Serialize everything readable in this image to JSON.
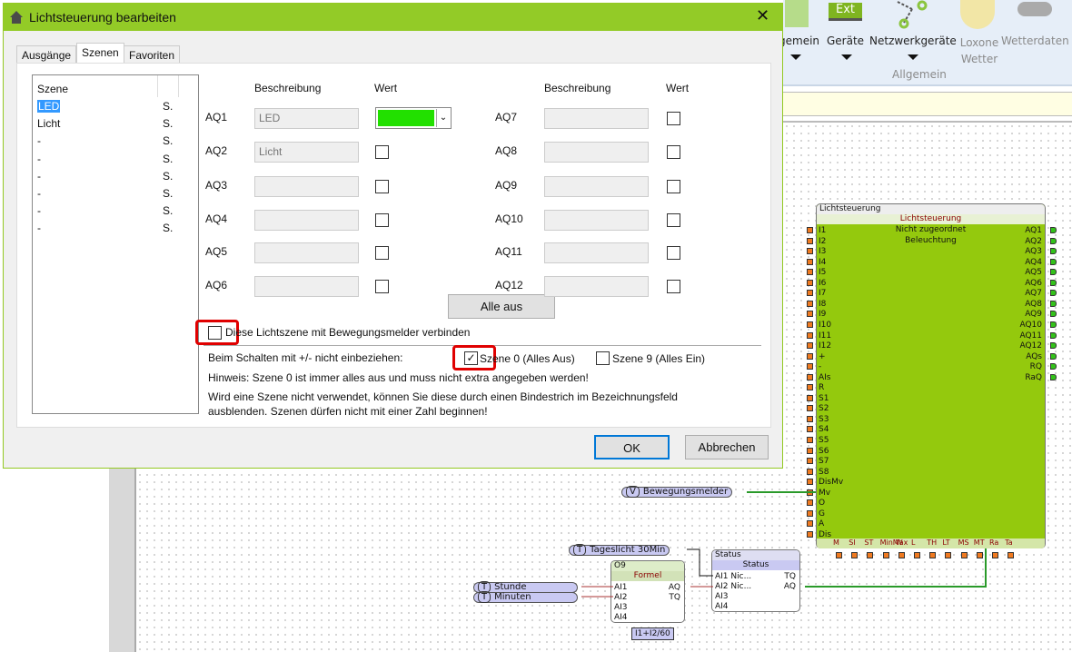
{
  "ribbon": {
    "items": [
      {
        "label": "gemein"
      },
      {
        "label": "Geräte"
      },
      {
        "label": "Netzwerkgeräte"
      },
      {
        "label": "Loxone Wetter"
      },
      {
        "label": "Wetterdaten"
      }
    ],
    "ext_label": "Ext",
    "group": "Allgemein"
  },
  "dialog": {
    "title": "Lichtsteuerung bearbeiten",
    "tabs": [
      "Ausgänge",
      "Szenen",
      "Favoriten"
    ],
    "active_tab": "Szenen",
    "scene_list": {
      "header": "Szene",
      "items": [
        {
          "name": "LED",
          "col": "S.",
          "selected": true
        },
        {
          "name": "Licht",
          "col": "S."
        },
        {
          "name": "-",
          "col": "S."
        },
        {
          "name": "-",
          "col": "S."
        },
        {
          "name": "-",
          "col": "S."
        },
        {
          "name": "-",
          "col": "S."
        },
        {
          "name": "-",
          "col": "S."
        },
        {
          "name": "-",
          "col": "S."
        }
      ]
    },
    "col_desc": "Beschreibung",
    "col_value": "Wert",
    "outputs_left": [
      {
        "label": "AQ1",
        "desc": "LED",
        "color": "#22e000"
      },
      {
        "label": "AQ2",
        "desc": "Licht"
      },
      {
        "label": "AQ3",
        "desc": ""
      },
      {
        "label": "AQ4",
        "desc": ""
      },
      {
        "label": "AQ5",
        "desc": ""
      },
      {
        "label": "AQ6",
        "desc": ""
      }
    ],
    "outputs_right": [
      {
        "label": "AQ7",
        "desc": ""
      },
      {
        "label": "AQ8",
        "desc": ""
      },
      {
        "label": "AQ9",
        "desc": ""
      },
      {
        "label": "AQ10",
        "desc": ""
      },
      {
        "label": "AQ11",
        "desc": ""
      },
      {
        "label": "AQ12",
        "desc": ""
      }
    ],
    "all_off": "Alle aus",
    "motion_checkbox": {
      "label": "Diese Lichtszene mit Bewegungsmelder verbinden",
      "checked": false
    },
    "exclude_label": "Beim Schalten mit +/- nicht einbeziehen:",
    "scene0": {
      "label": "Szene 0 (Alles Aus)",
      "checked": true
    },
    "scene9": {
      "label": "Szene 9 (Alles Ein)",
      "checked": false
    },
    "hint1": "Hinweis: Szene 0 ist immer alles aus und muss nicht extra angegeben werden!",
    "hint2": "Wird eine Szene nicht verwendet, können Sie diese durch einen Bindestrich im Bezeichnungsfeld",
    "hint3": "ausblenden. Szenen dürfen nicht mit einer Zahl beginnen!",
    "ok": "OK",
    "cancel": "Abbrechen"
  },
  "block": {
    "title": "Lichtsteuerung",
    "subtitle": "Lichtsteuerung",
    "line1": "Nicht zugeordnet",
    "line2": "Beleuchtung",
    "inputs": [
      "I1",
      "I2",
      "I3",
      "I4",
      "I5",
      "I6",
      "I7",
      "I8",
      "I9",
      "I10",
      "I11",
      "I12",
      "+",
      "-",
      "AIs",
      "R",
      "S1",
      "S2",
      "S3",
      "S4",
      "S5",
      "S6",
      "S7",
      "S8",
      "DisMv",
      "Mv",
      "O",
      "G",
      "A",
      "Dis"
    ],
    "outputs": [
      "AQ1",
      "AQ2",
      "AQ3",
      "AQ4",
      "AQ5",
      "AQ6",
      "AQ7",
      "AQ8",
      "AQ9",
      "AQ10",
      "AQ11",
      "AQ12",
      "AQs",
      "RQ",
      "RaQ"
    ],
    "params": [
      "M",
      "SI",
      "ST",
      "MinMax",
      "W",
      "L",
      "TH",
      "LT",
      "MS",
      "MT",
      "Ra",
      "Ta"
    ]
  },
  "motion_input": {
    "tag": "V",
    "label": "Bewegungsmelder"
  },
  "daylight": {
    "tag": "T",
    "label": "Tageslicht 30Min"
  },
  "hour": {
    "tag": "T",
    "label": "Stunde"
  },
  "minutes": {
    "tag": "T",
    "label": "Minuten"
  },
  "formula": {
    "title": "O9",
    "subtitle": "Formel",
    "inputs": [
      "AI1",
      "AI2",
      "AI3",
      "AI4"
    ],
    "outputs": [
      "AQ",
      "TQ"
    ],
    "expr": "I1+I2/60"
  },
  "status": {
    "title": "Status",
    "subtitle": "Status",
    "inputs": [
      "AI1 Nic...",
      "AI2 Nic...",
      "AI3",
      "AI4"
    ],
    "outputs": [
      "TQ",
      "AQ"
    ]
  }
}
